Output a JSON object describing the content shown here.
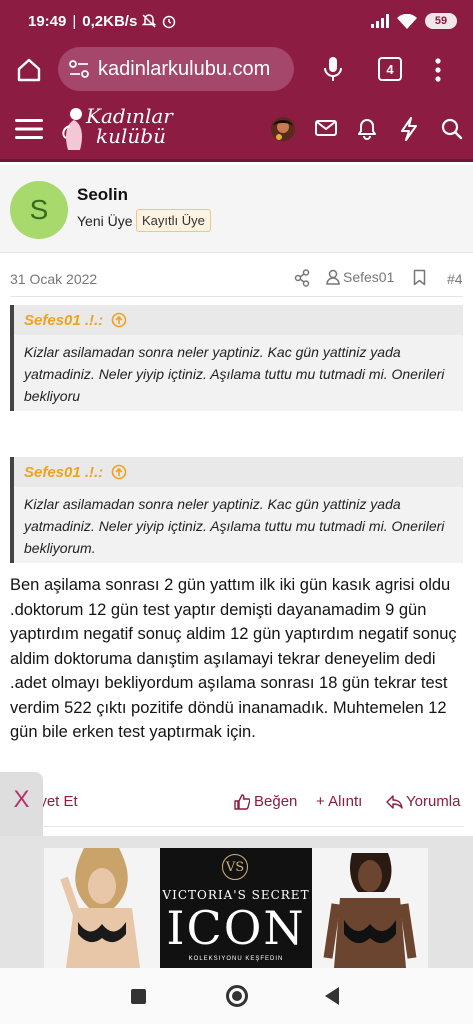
{
  "status_bar": {
    "time": "19:49",
    "separator": "|",
    "network_speed": "0,2KB/s",
    "battery": "59"
  },
  "browser": {
    "url": "kadinlarkulubu.com",
    "tab_count": "4"
  },
  "site": {
    "logo_line1": "Kadınlar",
    "logo_line2": "kulübü"
  },
  "post": {
    "author": {
      "avatar_letter": "S",
      "name": "Seolin",
      "user_title": "Yeni Üye",
      "badge": "Kayıtlı Üye"
    },
    "date": "31 Ocak 2022",
    "quoted_user": "Sefes01",
    "post_number": "#4",
    "quotes": [
      {
        "author": "Sefes01 .!.:",
        "text": "Kizlar asilamadan sonra neler yaptiniz. Kac gün yattiniz yada yatmadiniz. Neler yiyip içtiniz. Aşılama tuttu mu tutmadi mi. Onerileri bekliyoru"
      },
      {
        "author": "Sefes01 .!.:",
        "text": "Kizlar asilamadan sonra neler yaptiniz. Kac gün yattiniz yada yatmadiniz. Neler yiyip içtiniz. Aşılama tuttu mu tutmadi mi. Onerileri bekliyorum."
      }
    ],
    "body": "Ben aşilama sonrası 2 gün yattım ilk iki gün kasık agrisi oldu .doktorum 12 gün test yaptır demişti dayanamadim 9 gün yaptırdım negatif sonuç aldim 12 gün yaptırdım negatif sonuç aldim doktoruma danıştim aşılamayi tekrar deneyelim dedi .adet olmayı bekliyordum aşılama sonrası 18 gün tekrar test verdim 522 çıktı pozitife döndü inanamadık. Muhtemelen 12 gün bile erken test yaptırmak için.",
    "actions": {
      "report": "iyet Et",
      "like": "Beğen",
      "quote": "+ Alıntı",
      "reply": "Yorumla"
    }
  },
  "ad": {
    "close_label": "X",
    "brand": "VICTORIA'S SECRET",
    "title": "ICON",
    "cta": "KOLEKSIYONU KEŞFEDIN"
  },
  "colors": {
    "brand": "#8c1c42",
    "quote_author": "#f0a21e",
    "badge_bg": "#fef3e0"
  },
  "icons": [
    "home-icon",
    "site-settings-icon",
    "microphone-icon",
    "more-vert-icon",
    "hamburger-menu-icon",
    "mail-icon",
    "bell-icon",
    "bolt-icon",
    "search-icon",
    "share-icon",
    "user-icon",
    "bookmark-icon",
    "thumbs-up-icon",
    "reply-icon",
    "arrow-up-circle-icon"
  ]
}
